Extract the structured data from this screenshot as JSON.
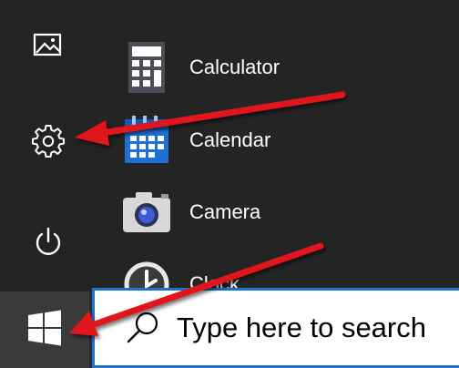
{
  "colors": {
    "menu_background": "#242424",
    "taskbar_background": "#2b2b2b",
    "search_border": "#1a73d1",
    "annotation_arrow": "#e0171b"
  },
  "left_rail": {
    "items": [
      {
        "icon": "pictures-icon"
      },
      {
        "icon": "settings-gear-icon"
      },
      {
        "icon": "power-icon"
      }
    ]
  },
  "apps": [
    {
      "label": "Calculator",
      "icon": "calculator-icon"
    },
    {
      "label": "Calendar",
      "icon": "calendar-icon"
    },
    {
      "label": "Camera",
      "icon": "camera-icon"
    },
    {
      "label": "Clock",
      "icon": "clock-icon"
    }
  ],
  "taskbar": {
    "start_icon": "windows-logo-icon",
    "search": {
      "icon": "search-icon",
      "placeholder": "Type here to search"
    }
  }
}
